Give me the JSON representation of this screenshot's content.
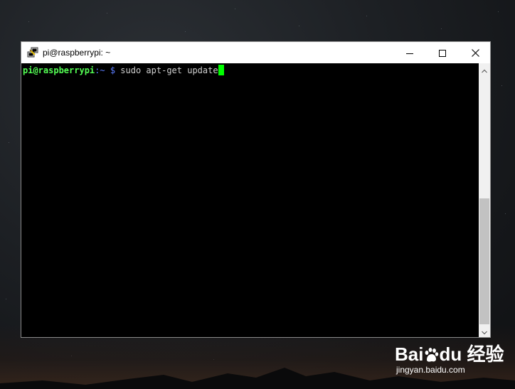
{
  "window": {
    "title": "pi@raspberrypi: ~",
    "icon": "putty-icon",
    "controls": {
      "minimize": "minimize-icon",
      "maximize": "maximize-icon",
      "close": "close-icon"
    }
  },
  "terminal": {
    "prompt_user": "pi@raspberrypi",
    "prompt_path": ":~ $",
    "command": "sudo apt-get update",
    "colors": {
      "background": "#000000",
      "user": "#54ff54",
      "path": "#5b7dff",
      "cursor": "#00ff00"
    }
  },
  "scrollbar": {
    "up": "chevron-up-icon",
    "down": "chevron-down-icon"
  },
  "watermark": {
    "brand": "Bai",
    "brand_suffix": "du",
    "product": "经验",
    "url": "jingyan.baidu.com"
  }
}
